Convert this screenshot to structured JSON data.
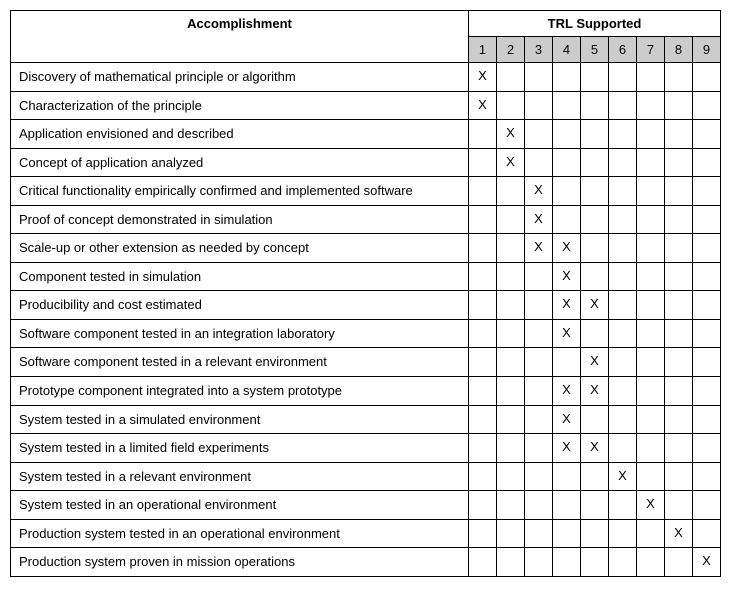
{
  "chart_data": {
    "type": "table",
    "title": "",
    "headers": {
      "accomplishment": "Accomplishment",
      "trl_supported": "TRL Supported",
      "levels": [
        "1",
        "2",
        "3",
        "4",
        "5",
        "6",
        "7",
        "8",
        "9"
      ]
    },
    "mark": "X",
    "rows": [
      {
        "accomplishment": "Discovery of mathematical principle or algorithm",
        "trl": [
          true,
          false,
          false,
          false,
          false,
          false,
          false,
          false,
          false
        ]
      },
      {
        "accomplishment": "Characterization of the principle",
        "trl": [
          true,
          false,
          false,
          false,
          false,
          false,
          false,
          false,
          false
        ]
      },
      {
        "accomplishment": "Application envisioned and described",
        "trl": [
          false,
          true,
          false,
          false,
          false,
          false,
          false,
          false,
          false
        ]
      },
      {
        "accomplishment": "Concept of application analyzed",
        "trl": [
          false,
          true,
          false,
          false,
          false,
          false,
          false,
          false,
          false
        ]
      },
      {
        "accomplishment": "Critical functionality empirically confirmed and implemented software",
        "trl": [
          false,
          false,
          true,
          false,
          false,
          false,
          false,
          false,
          false
        ]
      },
      {
        "accomplishment": "Proof of concept demonstrated in simulation",
        "trl": [
          false,
          false,
          true,
          false,
          false,
          false,
          false,
          false,
          false
        ]
      },
      {
        "accomplishment": "Scale-up or other extension as needed by concept",
        "trl": [
          false,
          false,
          true,
          true,
          false,
          false,
          false,
          false,
          false
        ]
      },
      {
        "accomplishment": "Component tested in simulation",
        "trl": [
          false,
          false,
          false,
          true,
          false,
          false,
          false,
          false,
          false
        ]
      },
      {
        "accomplishment": "Producibility and cost estimated",
        "trl": [
          false,
          false,
          false,
          true,
          true,
          false,
          false,
          false,
          false
        ]
      },
      {
        "accomplishment": "Software component tested in an integration laboratory",
        "trl": [
          false,
          false,
          false,
          true,
          false,
          false,
          false,
          false,
          false
        ]
      },
      {
        "accomplishment": "Software component tested in a relevant environment",
        "trl": [
          false,
          false,
          false,
          false,
          true,
          false,
          false,
          false,
          false
        ]
      },
      {
        "accomplishment": "Prototype component integrated into a system prototype",
        "trl": [
          false,
          false,
          false,
          true,
          true,
          false,
          false,
          false,
          false
        ]
      },
      {
        "accomplishment": "System tested in a simulated environment",
        "trl": [
          false,
          false,
          false,
          true,
          false,
          false,
          false,
          false,
          false
        ]
      },
      {
        "accomplishment": "System tested in a limited field experiments",
        "trl": [
          false,
          false,
          false,
          true,
          true,
          false,
          false,
          false,
          false
        ]
      },
      {
        "accomplishment": "System tested in a relevant environment",
        "trl": [
          false,
          false,
          false,
          false,
          false,
          true,
          false,
          false,
          false
        ]
      },
      {
        "accomplishment": "System tested in an operational environment",
        "trl": [
          false,
          false,
          false,
          false,
          false,
          false,
          true,
          false,
          false
        ]
      },
      {
        "accomplishment": "Production system tested in an operational environment",
        "trl": [
          false,
          false,
          false,
          false,
          false,
          false,
          false,
          true,
          false
        ]
      },
      {
        "accomplishment": "Production system proven in mission operations",
        "trl": [
          false,
          false,
          false,
          false,
          false,
          false,
          false,
          false,
          true
        ]
      }
    ]
  }
}
